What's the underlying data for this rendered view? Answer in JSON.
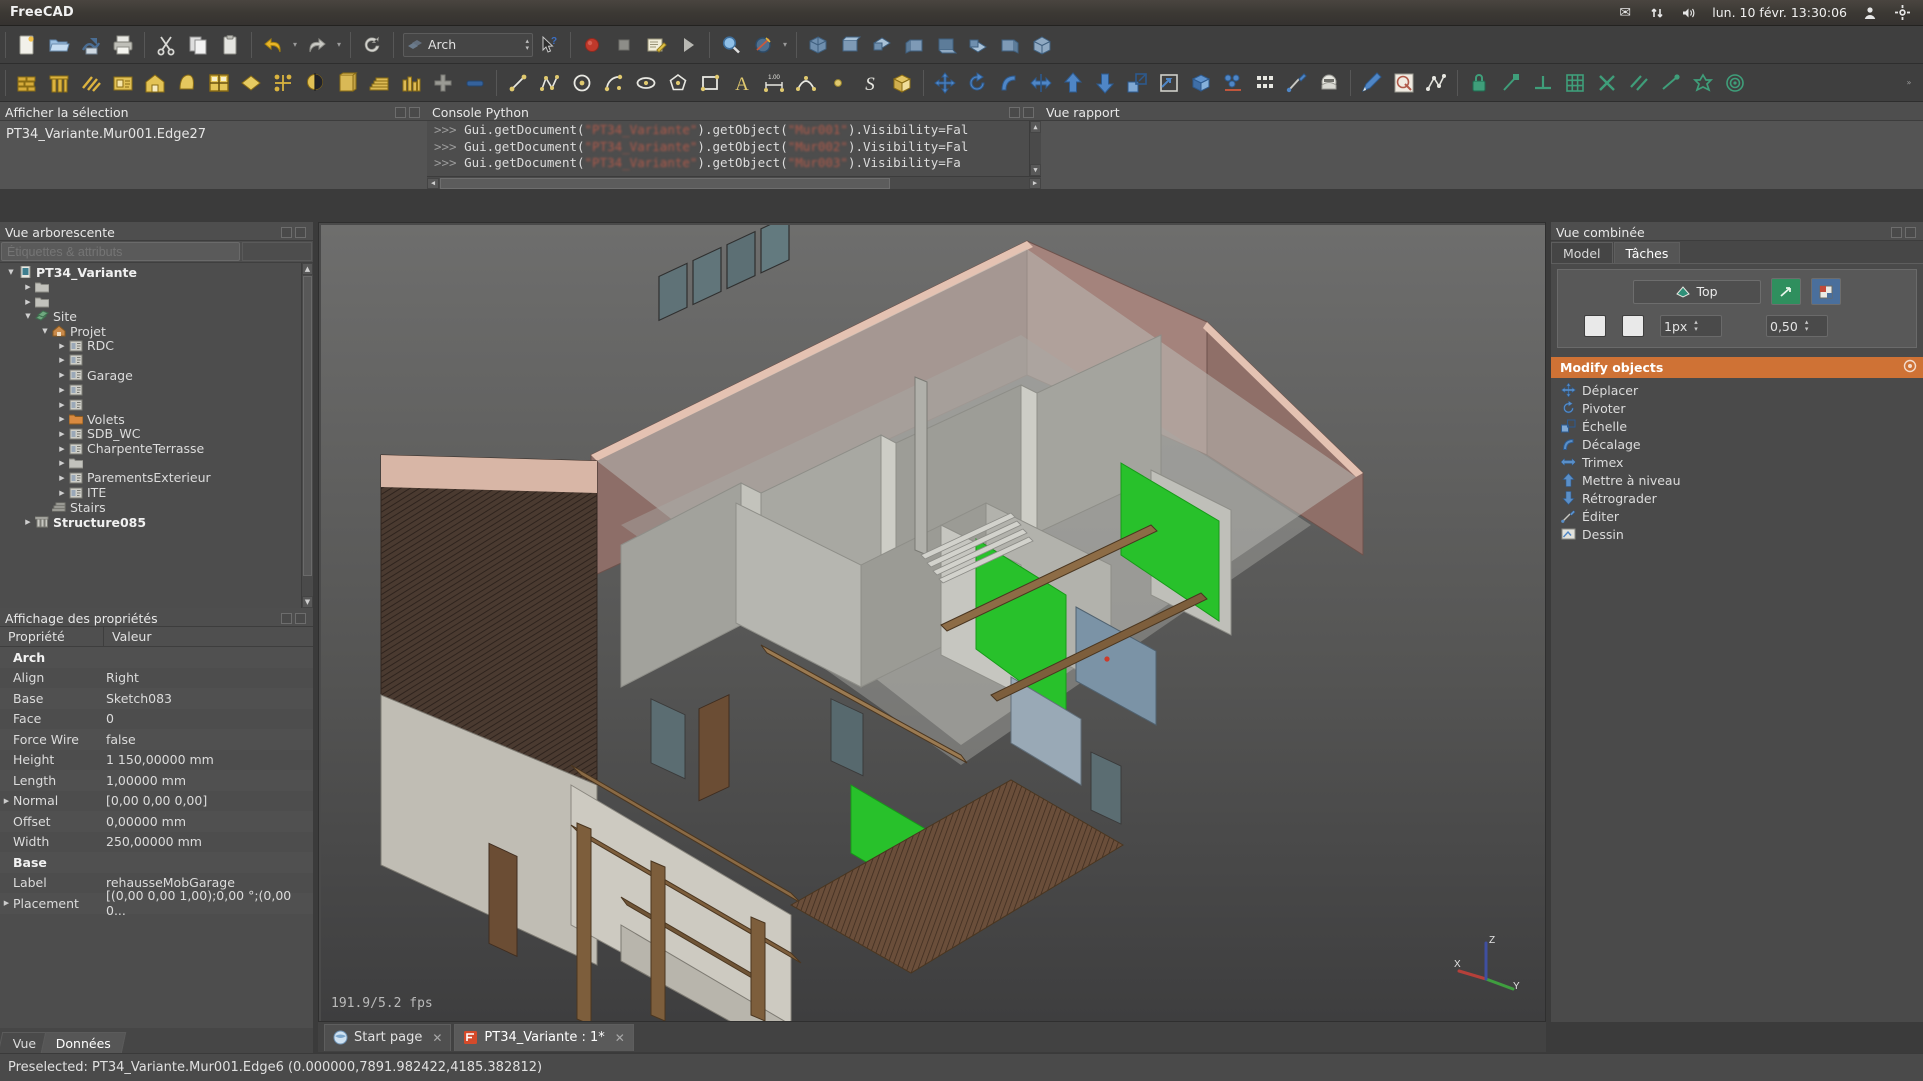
{
  "desktop": {
    "app_title": "FreeCAD",
    "tray": {
      "mail_icon": "mail-icon",
      "network_icon": "network-updown-icon",
      "volume_icon": "volume-icon",
      "clock": "lun. 10 févr. 13:30:06",
      "user_icon": "user-icon",
      "power_icon": "power-gear-icon"
    }
  },
  "toolbar1": {
    "items": [
      {
        "name": "new-document-button",
        "icon": "new-file-icon"
      },
      {
        "name": "open-document-button",
        "icon": "open-folder-icon"
      },
      {
        "name": "save-document-button",
        "icon": "save-icon"
      },
      {
        "name": "print-button",
        "icon": "printer-icon"
      },
      {
        "name": "cut-button",
        "icon": "scissors-icon"
      },
      {
        "name": "copy-button",
        "icon": "copy-icon"
      },
      {
        "name": "paste-button",
        "icon": "clipboard-icon"
      },
      {
        "name": "undo-button",
        "icon": "undo-arrow-icon"
      },
      {
        "name": "undo-dropdown",
        "icon": "chevron-down-icon"
      },
      {
        "name": "redo-button",
        "icon": "redo-arrow-icon"
      },
      {
        "name": "redo-dropdown",
        "icon": "chevron-down-icon"
      },
      {
        "name": "refresh-button",
        "icon": "refresh-icon"
      }
    ],
    "workbench_label": "Arch",
    "workbench_icon": "arch-workbench-icon",
    "whats_this_icon": "whats-this-icon",
    "macro_items": [
      {
        "name": "macro-record-button",
        "icon": "record-red-circle-icon"
      },
      {
        "name": "macro-stop-button",
        "icon": "stop-square-icon"
      },
      {
        "name": "macros-dialog-button",
        "icon": "macro-edit-icon"
      },
      {
        "name": "macro-execute-button",
        "icon": "play-triangle-icon"
      }
    ],
    "view_items": [
      {
        "name": "zoom-fit-button",
        "icon": "magnifier-icon"
      },
      {
        "name": "draw-style-button",
        "icon": "draw-style-icon"
      },
      {
        "name": "draw-style-dropdown",
        "icon": "chevron-down-icon"
      },
      {
        "name": "axonometric-view-button",
        "icon": "axonometric-cube-icon"
      },
      {
        "name": "front-view-button",
        "icon": "view-front-icon"
      },
      {
        "name": "top-view-button",
        "icon": "view-top-icon"
      },
      {
        "name": "right-view-button",
        "icon": "view-right-icon"
      },
      {
        "name": "rear-view-button",
        "icon": "view-rear-icon"
      },
      {
        "name": "bottom-view-button",
        "icon": "view-bottom-icon"
      },
      {
        "name": "left-view-button",
        "icon": "view-left-icon"
      },
      {
        "name": "isometric-view-button",
        "icon": "view-iso-icon"
      }
    ]
  },
  "toolbar2": {
    "arch_items": [
      {
        "name": "arch-wall-button",
        "icon": "wall-brick-icon"
      },
      {
        "name": "arch-structure-button",
        "icon": "structure-column-icon"
      },
      {
        "name": "arch-rebar-button",
        "icon": "rebar-icon"
      },
      {
        "name": "arch-floor-button",
        "icon": "floor-level-icon"
      },
      {
        "name": "arch-building-button",
        "icon": "building-house-icon"
      },
      {
        "name": "arch-site-button",
        "icon": "site-terrain-icon"
      },
      {
        "name": "arch-window-button",
        "icon": "window-icon"
      },
      {
        "name": "arch-roof-button",
        "icon": "roof-icon"
      },
      {
        "name": "arch-axis-button",
        "icon": "axis-system-icon"
      },
      {
        "name": "arch-section-plane-button",
        "icon": "section-plane-icon"
      },
      {
        "name": "arch-space-button",
        "icon": "space-box-icon"
      },
      {
        "name": "arch-stairs-button",
        "icon": "stairs-icon"
      },
      {
        "name": "arch-panel-button",
        "icon": "panel-icon"
      },
      {
        "name": "arch-add-button",
        "icon": "plus-icon"
      },
      {
        "name": "arch-remove-button",
        "icon": "minus-bar-icon"
      }
    ],
    "draft_items": [
      {
        "name": "draft-line-button",
        "icon": "line-icon"
      },
      {
        "name": "draft-polyline-button",
        "icon": "polyline-icon"
      },
      {
        "name": "draft-circle-button",
        "icon": "circle-icon"
      },
      {
        "name": "draft-arc-button",
        "icon": "arc-icon"
      },
      {
        "name": "draft-ellipse-button",
        "icon": "ellipse-icon"
      },
      {
        "name": "draft-polygon-button",
        "icon": "polygon-icon"
      },
      {
        "name": "draft-rectangle-button",
        "icon": "rectangle-icon"
      },
      {
        "name": "draft-text-button",
        "icon": "text-a-icon"
      },
      {
        "name": "draft-dimension-button",
        "icon": "dimension-icon"
      },
      {
        "name": "draft-bspline-button",
        "icon": "bspline-icon"
      },
      {
        "name": "draft-point-button",
        "icon": "point-dot-icon"
      },
      {
        "name": "draft-shapestring-button",
        "icon": "shapestring-s-icon"
      },
      {
        "name": "draft-facebinder-button",
        "icon": "facebinder-icon"
      }
    ],
    "modify_items": [
      {
        "name": "draft-move-button",
        "icon": "move-cross-arrows-icon"
      },
      {
        "name": "draft-rotate-button",
        "icon": "rotate-icon"
      },
      {
        "name": "draft-offset-button",
        "icon": "offset-icon"
      },
      {
        "name": "draft-trimex-button",
        "icon": "trimex-icon"
      },
      {
        "name": "draft-upgrade-button",
        "icon": "arrow-up-icon"
      },
      {
        "name": "draft-downgrade-button",
        "icon": "arrow-down-icon"
      },
      {
        "name": "draft-scale-button",
        "icon": "scale-icon"
      },
      {
        "name": "draft-shape2dview-button",
        "icon": "shape-2d-view-icon"
      },
      {
        "name": "draft-draft2sketch-button",
        "icon": "draft-to-sketch-icon"
      },
      {
        "name": "draft-array-button",
        "icon": "array-icon"
      },
      {
        "name": "draft-clone-button",
        "icon": "clone-icon"
      },
      {
        "name": "draft-edit-button",
        "icon": "edit-node-icon"
      },
      {
        "name": "draft-wire-to-bspline-button",
        "icon": "wire-bspline-icon"
      },
      {
        "name": "draft-pencil-button",
        "icon": "pencil-icon"
      },
      {
        "name": "draft-mirror-button",
        "icon": "mirror-icon"
      },
      {
        "name": "draft-stretch-button",
        "icon": "stretch-polyline-icon"
      }
    ],
    "snap_items": [
      {
        "name": "snap-lock-button",
        "icon": "snap-lock-icon"
      },
      {
        "name": "snap-endpoint-button",
        "icon": "snap-endpoint-icon"
      },
      {
        "name": "snap-midpoint-button",
        "icon": "snap-midpoint-icon"
      },
      {
        "name": "snap-grid-button",
        "icon": "snap-grid-icon"
      },
      {
        "name": "snap-intersection-button",
        "icon": "snap-intersection-icon"
      },
      {
        "name": "snap-parallel-button",
        "icon": "snap-parallel-icon"
      },
      {
        "name": "snap-perpendicular-button",
        "icon": "snap-perpendicular-icon"
      },
      {
        "name": "snap-special-button",
        "icon": "snap-special-icon"
      },
      {
        "name": "snap-center-button",
        "icon": "snap-center-icon"
      }
    ],
    "overflow_icon": "double-chevron-right-icon"
  },
  "selection_view": {
    "title": "Afficher la sélection",
    "entry": "PT34_Variante.Mur001.Edge27"
  },
  "python_console": {
    "title": "Console Python",
    "lines": [
      {
        "prompt": ">>>",
        "pre": "Gui.getDocument(",
        "arg1": "\"PT34_Variante\"",
        "mid": ").getObject(",
        "arg2": "\"Mur001\"",
        "post": ").Visibility=Fal"
      },
      {
        "prompt": ">>>",
        "pre": "Gui.getDocument(",
        "arg1": "\"PT34_Variante\"",
        "mid": ").getObject(",
        "arg2": "\"Mur002\"",
        "post": ").Visibility=Fal"
      },
      {
        "prompt": ">>>",
        "pre": "Gui.getDocument(",
        "arg1": "\"PT34_Variante\"",
        "mid": ").getObject(",
        "arg2": "\"Mur003\"",
        "post": ").Visibility=Fa"
      },
      {
        "prompt": ">>>",
        "pre": "",
        "arg1": "",
        "mid": "",
        "arg2": "",
        "post": ""
      }
    ]
  },
  "report_view": {
    "title": "Vue rapport",
    "content": ""
  },
  "tree_view": {
    "title": "Vue arborescente",
    "search_placeholder": "Étiquettes & attributs",
    "nodes": [
      {
        "label": "PT34_Variante",
        "icon": "document-icon",
        "depth": 0,
        "expander": "▼",
        "bold": true
      },
      {
        "label": "",
        "icon": "folder-icon",
        "depth": 1,
        "expander": "▶",
        "bold": false
      },
      {
        "label": "",
        "icon": "folder-icon",
        "depth": 1,
        "expander": "▶",
        "bold": false
      },
      {
        "label": "Site",
        "icon": "site-icon",
        "depth": 1,
        "expander": "▼",
        "bold": false
      },
      {
        "label": "Projet",
        "icon": "building-icon",
        "depth": 2,
        "expander": "▼",
        "bold": false
      },
      {
        "label": "RDC",
        "icon": "floor-icon",
        "depth": 3,
        "expander": "▶",
        "bold": false
      },
      {
        "label": "",
        "icon": "floor-icon",
        "depth": 3,
        "expander": "▶",
        "bold": false
      },
      {
        "label": "Garage",
        "icon": "floor-icon",
        "depth": 3,
        "expander": "▶",
        "bold": false
      },
      {
        "label": "",
        "icon": "floor-icon",
        "depth": 3,
        "expander": "▶",
        "bold": false
      },
      {
        "label": "",
        "icon": "floor-icon",
        "depth": 3,
        "expander": "▶",
        "bold": false
      },
      {
        "label": "Volets",
        "icon": "folder-orange-icon",
        "depth": 3,
        "expander": "▶",
        "bold": false
      },
      {
        "label": "SDB_WC",
        "icon": "floor-icon",
        "depth": 3,
        "expander": "▶",
        "bold": false
      },
      {
        "label": "CharpenteTerrasse",
        "icon": "floor-icon",
        "depth": 3,
        "expander": "▶",
        "bold": false
      },
      {
        "label": "",
        "icon": "folder-icon",
        "depth": 3,
        "expander": "▶",
        "bold": false
      },
      {
        "label": "ParementsExterieur",
        "icon": "floor-icon",
        "depth": 3,
        "expander": "▶",
        "bold": false
      },
      {
        "label": "ITE",
        "icon": "floor-icon",
        "depth": 3,
        "expander": "▶",
        "bold": false
      },
      {
        "label": "Stairs",
        "icon": "stairs-icon",
        "depth": 2,
        "expander": "",
        "bold": false
      },
      {
        "label": "Structure085",
        "icon": "structure-icon",
        "depth": 1,
        "expander": "▶",
        "bold": true
      }
    ]
  },
  "property_view": {
    "title": "Affichage des propriétés",
    "col_property": "Propriété",
    "col_value": "Valeur",
    "rows": [
      {
        "name": "Arch",
        "value": "",
        "group": true,
        "expander": ""
      },
      {
        "name": "Align",
        "value": "Right",
        "group": false,
        "expander": ""
      },
      {
        "name": "Base",
        "value": "Sketch083",
        "group": false,
        "expander": ""
      },
      {
        "name": "Face",
        "value": "0",
        "group": false,
        "expander": ""
      },
      {
        "name": "Force Wire",
        "value": "false",
        "group": false,
        "expander": ""
      },
      {
        "name": "Height",
        "value": "1 150,00000 mm",
        "group": false,
        "expander": ""
      },
      {
        "name": "Length",
        "value": "1,00000 mm",
        "group": false,
        "expander": ""
      },
      {
        "name": "Normal",
        "value": "[0,00 0,00 0,00]",
        "group": false,
        "expander": "▶"
      },
      {
        "name": "Offset",
        "value": "0,00000 mm",
        "group": false,
        "expander": ""
      },
      {
        "name": "Width",
        "value": "250,00000 mm",
        "group": false,
        "expander": ""
      },
      {
        "name": "Base",
        "value": "",
        "group": true,
        "expander": ""
      },
      {
        "name": "Label",
        "value": "rehausseMobGarage",
        "group": false,
        "expander": ""
      },
      {
        "name": "Placement",
        "value": "[(0,00 0,00 1,00);0,00 °;(0,00 0...",
        "group": false,
        "expander": "▶"
      }
    ],
    "tabs": [
      {
        "label": "Vue",
        "active": false
      },
      {
        "label": "Données",
        "active": true
      }
    ]
  },
  "view3d": {
    "fps": "191.9/5.2 fps",
    "axis": {
      "x": "X",
      "y": "Y",
      "z": "Z",
      "x_color": "#b5403a",
      "y_color": "#3f9e3f",
      "z_color": "#3f4fa0"
    }
  },
  "combined_view": {
    "title": "Vue combinée",
    "tabs": [
      {
        "label": "Model",
        "active": false
      },
      {
        "label": "Tâches",
        "active": true
      }
    ],
    "working_plane": {
      "top_button_label": "Top",
      "top_button_icon": "working-plane-icon",
      "set_wp_icon": "set-working-plane-icon",
      "wp_proxy_icon": "working-plane-proxy-icon",
      "checkbox_1": "grid-checkbox",
      "checkbox_2": "snap-checkbox",
      "line_width_value": "1px",
      "transparency_value": "0,50"
    },
    "modify_group": {
      "header": "Modify objects",
      "header_icon": "settings-gear-icon",
      "commands": [
        {
          "label": "Déplacer",
          "icon": "move-cross-arrows-icon"
        },
        {
          "label": "Pivoter",
          "icon": "rotate-icon"
        },
        {
          "label": "Échelle",
          "icon": "scale-icon"
        },
        {
          "label": "Décalage",
          "icon": "offset-icon"
        },
        {
          "label": "Trimex",
          "icon": "trimex-icon"
        },
        {
          "label": "Mettre à niveau",
          "icon": "arrow-up-icon"
        },
        {
          "label": "Rétrograder",
          "icon": "arrow-down-icon"
        },
        {
          "label": "Éditer",
          "icon": "edit-node-icon"
        },
        {
          "label": "Dessin",
          "icon": "drawing-icon"
        }
      ]
    }
  },
  "document_tabs": [
    {
      "label": "Start page",
      "icon": "start-page-icon",
      "active": false,
      "close": "✕"
    },
    {
      "label": "PT34_Variante : 1*",
      "icon": "freecad-doc-icon",
      "active": true,
      "close": "✕"
    }
  ],
  "status_bar": {
    "message": "Preselected: PT34_Variante.Mur001.Edge6 (0.000000,7891.982422,4185.382812)"
  },
  "colors": {
    "accent_orange": "#cf7235",
    "panel_bg": "#4a4a4a",
    "toolbar_bg": "#3f3f3f",
    "text": "#dcdcdc"
  }
}
